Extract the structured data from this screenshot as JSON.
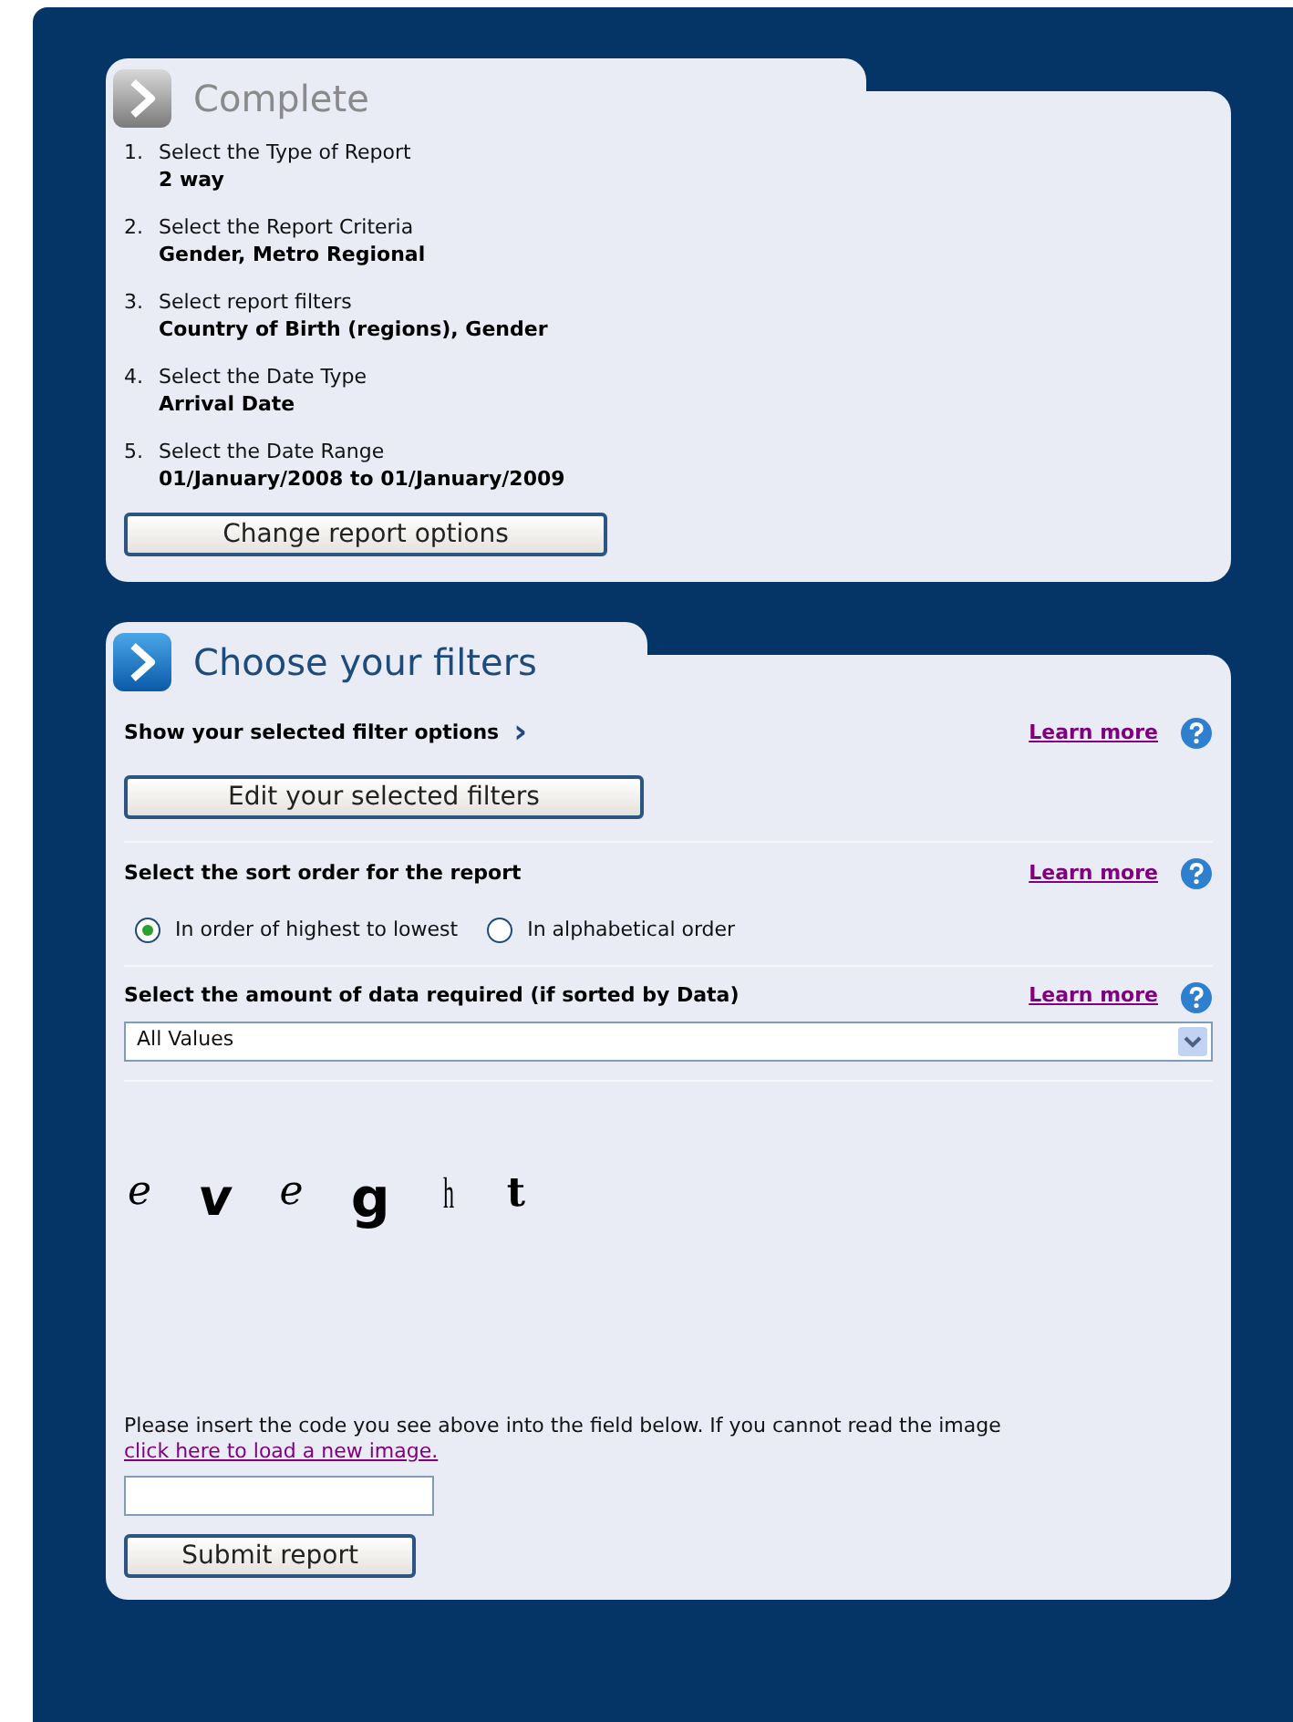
{
  "completed": {
    "title": "Complete",
    "steps": [
      {
        "number": "1.",
        "label": "Select the Type of Report",
        "value": "2 way"
      },
      {
        "number": "2.",
        "label": "Select the Report Criteria",
        "value": "Gender, Metro Regional"
      },
      {
        "number": "3.",
        "label": "Select report filters",
        "value": "Country of Birth (regions), Gender"
      },
      {
        "number": "4.",
        "label": "Select the Date Type",
        "value": "Arrival Date"
      },
      {
        "number": "5.",
        "label": "Select the Date Range",
        "value": "01/January/2008 to 01/January/2009"
      }
    ],
    "button": "Change report options"
  },
  "filters": {
    "title": "Choose your filters",
    "sections": [
      {
        "kind": "button",
        "heading": "Show your selected filter options",
        "chevron": "›",
        "learn_more": "Learn more",
        "button": "Edit your selected filters"
      },
      {
        "kind": "radio",
        "heading": "Select the sort order for the report",
        "learn_more": "Learn more",
        "options": [
          {
            "label": "In order of highest to lowest",
            "selected": true
          },
          {
            "label": "In alphabetical order",
            "selected": false
          }
        ]
      },
      {
        "kind": "select",
        "heading": "Select the amount of data required (if sorted by Data)",
        "learn_more": "Learn more",
        "value": "All Values"
      }
    ]
  },
  "captcha": {
    "characters": [
      "e",
      "v",
      "e",
      "g",
      "h",
      "t"
    ],
    "instructions": "Please insert the code you see above into the field below. If you cannot read the image",
    "link": "click here to load a new image.",
    "button": "Submit report"
  }
}
